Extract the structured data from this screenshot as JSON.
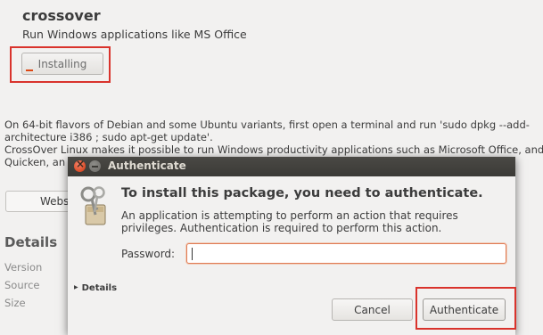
{
  "app": {
    "name": "crossover",
    "subtitle": "Run Windows applications like MS Office",
    "install_label": "Installing",
    "install_progress": 0.05,
    "description": "On 64-bit flavors of Debian and some Ubuntu variants, first open a terminal and run 'sudo dpkg --add-\narchitecture i386 ; sudo apt-get update'.\nCrossOver Linux makes it possible to run Windows productivity applications such as Microsoft Office, and\nQuicken, an",
    "website_label": "Webs",
    "details_heading": "Details",
    "meta": {
      "version": "Version",
      "source": "Source",
      "size": "Size"
    }
  },
  "dialog": {
    "title": "Authenticate",
    "heading": "To install this package, you need to authenticate.",
    "message": "An application is attempting to perform an action that requires privileges. Authentication is required to perform this action.",
    "password_label": "Password:",
    "password_value": "",
    "details_label": "Details",
    "cancel_label": "Cancel",
    "authenticate_label": "Authenticate"
  },
  "colors": {
    "highlight": "#d9332c",
    "titlebar": "#3b3a36",
    "progress": "#dd4814"
  }
}
